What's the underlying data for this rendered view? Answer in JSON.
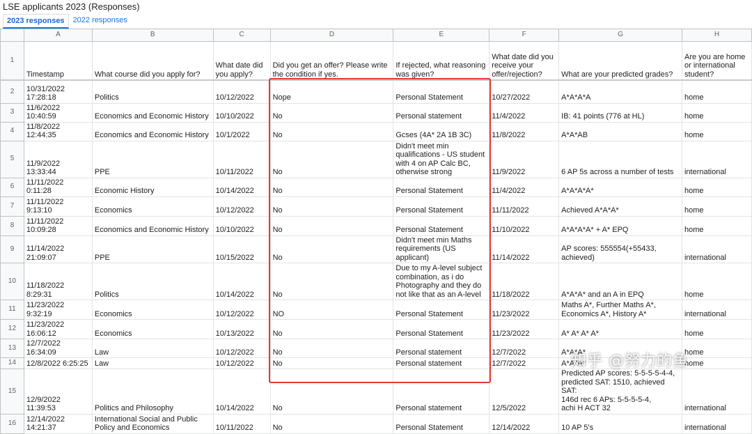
{
  "doc_title": "LSE applicants 2023 (Responses)",
  "tabs": [
    {
      "label": "2023 responses",
      "active": true
    },
    {
      "label": "2022 responses",
      "active": false
    }
  ],
  "columns": [
    "A",
    "B",
    "C",
    "D",
    "E",
    "F",
    "G",
    "H"
  ],
  "headers": [
    "Timestamp",
    "What course did you apply for?",
    "What date did you apply?",
    "Did you get an offer? Please write the condition if yes.",
    "If rejected, what reasoning was given?",
    "What date did you receive your offer/rejection?",
    "What are your predicted grades?",
    "Are you are home or international student?"
  ],
  "rows": [
    {
      "num": "2",
      "cells": [
        "10/31/2022\n17:28:18",
        "Politics",
        "10/12/2022",
        "Nope",
        "Personal Statement",
        "10/27/2022",
        "A*A*A*A",
        "home"
      ]
    },
    {
      "num": "3",
      "cells": [
        "11/6/2022 10:40:59",
        "Economics and Economic History",
        "10/10/2022",
        "No",
        "Personal statement",
        "11/4/2022",
        "IB: 41 points (776 at HL)",
        "home"
      ]
    },
    {
      "num": "4",
      "cells": [
        "11/8/2022 12:44:35",
        "Economics and Economic History",
        "10/1/2022",
        "No",
        "Gcses (4A* 2A 1B 3C)",
        "11/8/2022",
        "A*A*AB",
        "home"
      ]
    },
    {
      "num": "5",
      "cells": [
        "11/9/2022 13:33:44",
        "PPE",
        "10/11/2022",
        "No",
        "Didn't meet min\nqualifications - US student\nwith 4 on AP Calc BC,\notherwise strong",
        "11/9/2022",
        "6 AP 5s across a number of tests",
        "international"
      ]
    },
    {
      "num": "6",
      "cells": [
        "11/11/2022 0:11:28",
        "Economic History",
        "10/14/2022",
        "No",
        "Personal Statement",
        "11/4/2022",
        "A*A*A*A*",
        "home"
      ]
    },
    {
      "num": "7",
      "cells": [
        "11/11/2022 9:13:10",
        "Economics",
        "10/12/2022",
        "No",
        "Personal Statement",
        "11/11/2022",
        "Achieved A*A*A*",
        "home"
      ]
    },
    {
      "num": "8",
      "cells": [
        "11/11/2022\n10:09:28",
        "Economics and Economic History",
        "10/10/2022",
        "No",
        "Personal Statement",
        "11/10/2022",
        "A*A*A*A* + A* EPQ",
        "home"
      ]
    },
    {
      "num": "9",
      "cells": [
        "11/14/2022\n21:09:07",
        "PPE",
        "10/15/2022",
        "No",
        "Didn't meet min Maths\nrequirements (US applicant)",
        "11/14/2022",
        "AP scores: 555554(+55433,\nachieved)",
        "international"
      ]
    },
    {
      "num": "10",
      "cells": [
        "11/18/2022 8:29:31",
        "Politics",
        "10/14/2022",
        "No",
        "Due to my A-level subject\ncombination, as i do\nPhotography and they do\nnot like that as an A-level",
        "11/18/2022",
        "A*A*A* and an A in EPQ",
        "home"
      ]
    },
    {
      "num": "11",
      "cells": [
        "11/23/2022 9:32:19",
        "Economics",
        "10/12/2022",
        "NO",
        "Personal Statement",
        "11/23/2022",
        "Maths A*, Further Maths A*,\nEconomics A*, History A*",
        "international"
      ]
    },
    {
      "num": "12",
      "cells": [
        "11/23/2022\n16:06:12",
        "Economics",
        "10/13/2022",
        "No",
        "Personal Statement",
        "11/23/2022",
        "A* A* A* A*",
        "home"
      ]
    },
    {
      "num": "13",
      "cells": [
        "12/7/2022 16:34:09",
        "Law",
        "10/12/2022",
        "No",
        "Personal statement",
        "12/7/2022",
        "A*A*A*",
        "home"
      ]
    },
    {
      "num": "14",
      "cells": [
        "12/8/2022 6:25:25",
        "Law",
        "10/12/2022",
        "No",
        "Personal statement",
        "12/7/2022",
        "A*A*A*",
        "home"
      ]
    },
    {
      "num": "15",
      "cells": [
        "12/9/2022 11:39:53",
        "Politics and Philosophy",
        "10/14/2022",
        "No",
        "Personal statement",
        "12/5/2022",
        "Predicted AP scores: 5-5-5-5-4-4,\npredicted SAT: 1510, achieved SAT:\n146d rec 6 APs: 5-5-5-5-4,\nachi H ACT 32",
        "international"
      ]
    },
    {
      "num": "16",
      "cells": [
        "12/14/2022\n14:21:37",
        "International Social and Public\nPolicy and Economics",
        "10/11/2022",
        "No",
        "Personal Statement",
        "12/14/2022",
        "10 AP 5's",
        "international"
      ]
    }
  ],
  "watermark": "知乎 @努力的鱼",
  "highlight_color": "#e53935",
  "accent_color": "#1a73e8"
}
